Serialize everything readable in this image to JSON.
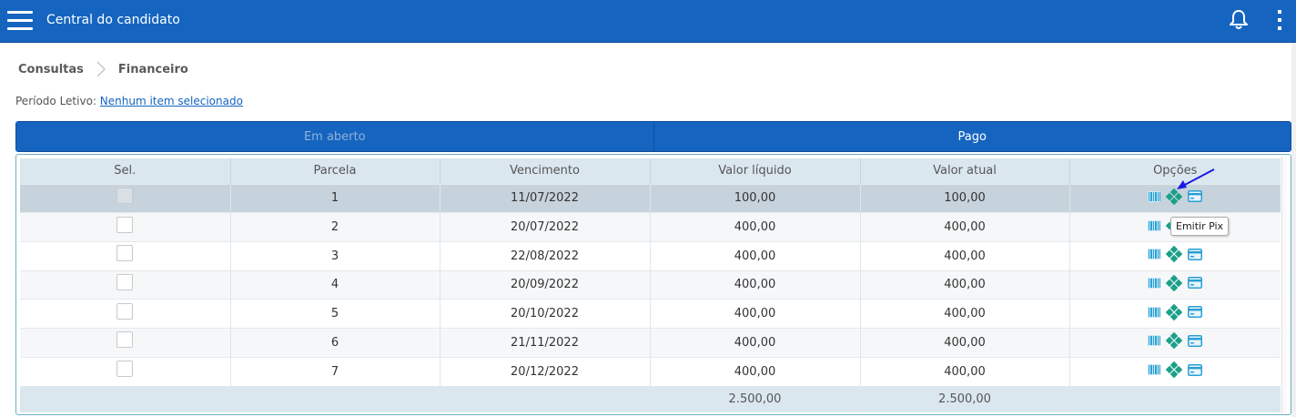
{
  "header": {
    "title": "Central do candidato",
    "menu_icon": "hamburger-menu-icon",
    "bell_icon": "bell-icon",
    "more_icon": "kebab-menu-icon",
    "brand_color": "#1565c0"
  },
  "breadcrumb": {
    "items": [
      "Consultas",
      "Financeiro"
    ]
  },
  "periodo": {
    "label": "Período Letivo:",
    "value": "Nenhum item selecionado"
  },
  "tabs": [
    {
      "label": "Em aberto",
      "active": false
    },
    {
      "label": "Pago",
      "active": true
    }
  ],
  "table": {
    "columns": [
      "Sel.",
      "Parcela",
      "Vencimento",
      "Valor líquido",
      "Valor atual",
      "Opções"
    ],
    "rows": [
      {
        "parcela": "1",
        "vencimento": "11/07/2022",
        "valor_liquido": "100,00",
        "valor_atual": "100,00"
      },
      {
        "parcela": "2",
        "vencimento": "20/07/2022",
        "valor_liquido": "400,00",
        "valor_atual": "400,00"
      },
      {
        "parcela": "3",
        "vencimento": "22/08/2022",
        "valor_liquido": "400,00",
        "valor_atual": "400,00"
      },
      {
        "parcela": "4",
        "vencimento": "20/09/2022",
        "valor_liquido": "400,00",
        "valor_atual": "400,00"
      },
      {
        "parcela": "5",
        "vencimento": "20/10/2022",
        "valor_liquido": "400,00",
        "valor_atual": "400,00"
      },
      {
        "parcela": "6",
        "vencimento": "21/11/2022",
        "valor_liquido": "400,00",
        "valor_atual": "400,00"
      },
      {
        "parcela": "7",
        "vencimento": "20/12/2022",
        "valor_liquido": "400,00",
        "valor_atual": "400,00"
      }
    ],
    "totals": {
      "valor_liquido": "2.500,00",
      "valor_atual": "2.500,00"
    },
    "option_icons": [
      "barcode-icon",
      "pix-icon",
      "credit-card-icon"
    ]
  },
  "tooltip": {
    "text": "Emitir Pix"
  }
}
